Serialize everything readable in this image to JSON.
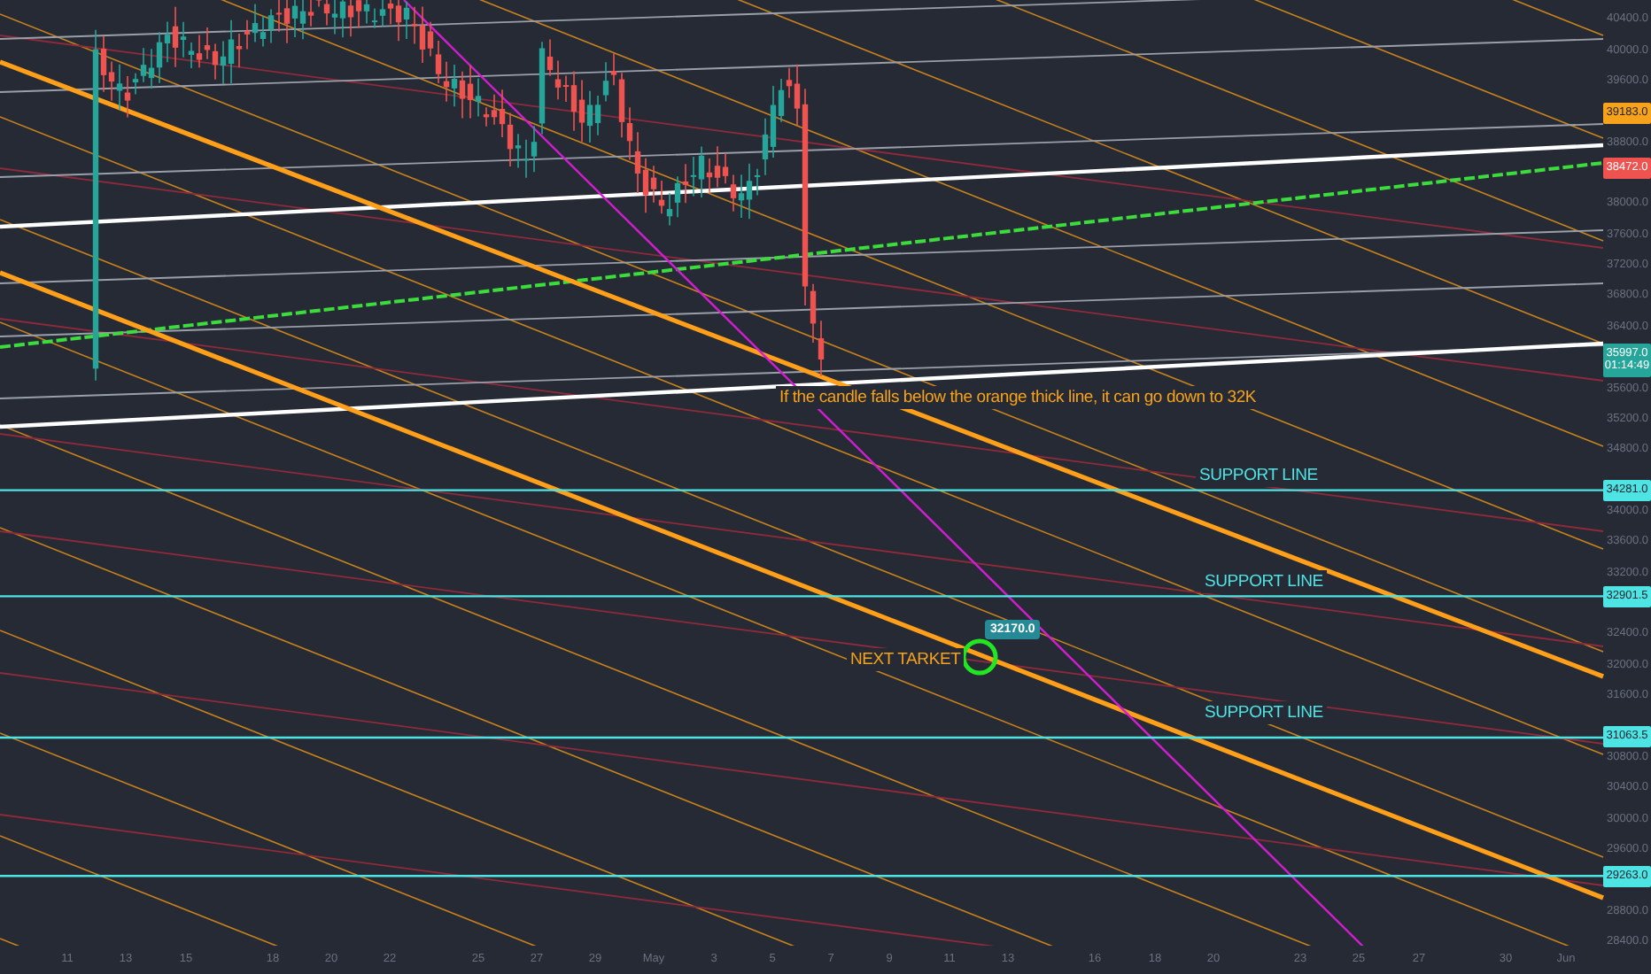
{
  "chart": {
    "annotations": [
      {
        "kind": "note",
        "text": "If the candle falls below the orange thick line, it can go down to 32K"
      },
      {
        "kind": "support",
        "text": "SUPPORT LINE"
      },
      {
        "kind": "support",
        "text": "SUPPORT LINE"
      },
      {
        "kind": "target",
        "text": "NEXT TARKET"
      },
      {
        "kind": "support",
        "text": "SUPPORT LINE"
      }
    ],
    "marker_label": "32170.0",
    "price_axis": {
      "ticks": [
        "40400.0",
        "40000.0",
        "39600.0",
        "38800.0",
        "38000.0",
        "37600.0",
        "37200.0",
        "36800.0",
        "36400.0",
        "35600.0",
        "35200.0",
        "34800.0",
        "34000.0",
        "33600.0",
        "33200.0",
        "32400.0",
        "32000.0",
        "31600.0",
        "30800.0",
        "30400.0",
        "30000.0",
        "29600.0",
        "28800.0",
        "28400.0"
      ],
      "tags": [
        {
          "text": "39183.0",
          "color": "#f7a21b"
        },
        {
          "text": "38472.0",
          "color": "#ef5350"
        },
        {
          "text": "35997.0",
          "subtext": "01:14:49",
          "color": "#26a69a"
        },
        {
          "text": "34281.0",
          "color": "#4ee4e4"
        },
        {
          "text": "32901.5",
          "color": "#4ee4e4"
        },
        {
          "text": "31063.5",
          "color": "#4ee4e4"
        },
        {
          "text": "29263.0",
          "color": "#4ee4e4"
        }
      ]
    },
    "time_axis": [
      "11",
      "13",
      "15",
      "18",
      "20",
      "22",
      "25",
      "27",
      "29",
      "May",
      "3",
      "5",
      "7",
      "9",
      "11",
      "13",
      "16",
      "18",
      "20",
      "23",
      "25",
      "27",
      "30",
      "Jun"
    ]
  }
}
